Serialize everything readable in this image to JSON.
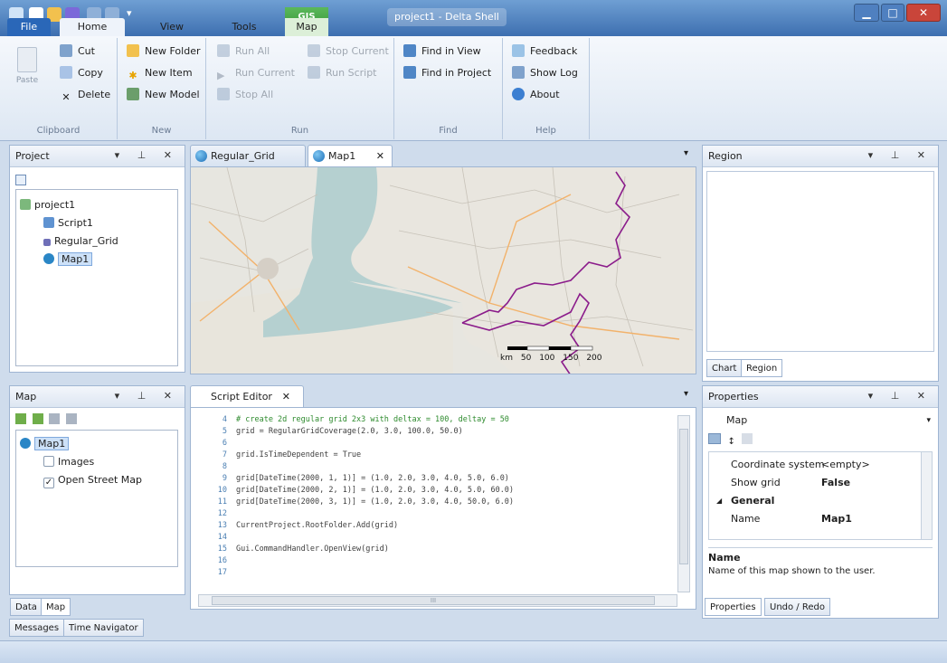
{
  "window": {
    "title": "project1 - Delta Shell",
    "contextual_tab_group": "GIS"
  },
  "ribbon_tabs": {
    "file": "File",
    "home": "Home",
    "view": "View",
    "tools": "Tools",
    "map": "Map"
  },
  "ribbon": {
    "clipboard": {
      "label": "Clipboard",
      "paste": "Paste",
      "cut": "Cut",
      "copy": "Copy",
      "delete": "Delete"
    },
    "new": {
      "label": "New",
      "new_folder": "New Folder",
      "new_item": "New Item",
      "new_model": "New Model"
    },
    "run": {
      "label": "Run",
      "run_all": "Run All",
      "run_current": "Run Current",
      "stop_all": "Stop All",
      "stop_current": "Stop Current",
      "run_script": "Run Script"
    },
    "find": {
      "label": "Find",
      "find_in_view": "Find in View",
      "find_in_project": "Find in Project"
    },
    "help": {
      "label": "Help",
      "feedback": "Feedback",
      "show_log": "Show Log",
      "about": "About"
    }
  },
  "project_panel": {
    "title": "Project",
    "tree": [
      {
        "label": "project1"
      },
      {
        "label": "Script1"
      },
      {
        "label": "Regular_Grid"
      },
      {
        "label": "Map1"
      }
    ]
  },
  "map_panel": {
    "title": "Map",
    "tree": [
      {
        "label": "Map1"
      },
      {
        "label": "Images"
      },
      {
        "label": "Open Street Map"
      }
    ],
    "bottom_tabs": [
      "Data",
      "Map"
    ]
  },
  "doc_tabs": [
    "Regular_Grid",
    "Map1"
  ],
  "map_view": {
    "scale_bar": {
      "unit": "km",
      "ticks": [
        "50",
        "100",
        "150",
        "200"
      ]
    }
  },
  "script_editor": {
    "tab": "Script Editor",
    "lines": [
      {
        "n": "4",
        "text": "# create 2d regular grid 2x3 with deltax = 100, deltay = 50"
      },
      {
        "n": "5",
        "text": "grid = RegularGridCoverage(2.0, 3.0, 100.0, 50.0)"
      },
      {
        "n": "6",
        "text": ""
      },
      {
        "n": "7",
        "text": "grid.IsTimeDependent = True"
      },
      {
        "n": "8",
        "text": ""
      },
      {
        "n": "9",
        "text": "grid[DateTime(2000, 1, 1)] = (1.0, 2.0, 3.0, 4.0, 5.0, 6.0)"
      },
      {
        "n": "10",
        "text": "grid[DateTime(2000, 2, 1)] = (1.0, 2.0, 3.0, 4.0, 5.0, 60.0)"
      },
      {
        "n": "11",
        "text": "grid[DateTime(2000, 3, 1)] = (1.0, 2.0, 3.0, 4.0, 50.0, 6.0)"
      },
      {
        "n": "12",
        "text": ""
      },
      {
        "n": "13",
        "text": "CurrentProject.RootFolder.Add(grid)"
      },
      {
        "n": "14",
        "text": ""
      },
      {
        "n": "15",
        "text": "Gui.CommandHandler.OpenView(grid)"
      },
      {
        "n": "16",
        "text": ""
      },
      {
        "n": "17",
        "text": ""
      }
    ],
    "hscroll_mark": "III"
  },
  "region_panel": {
    "title": "Region",
    "tabs": [
      "Chart",
      "Region"
    ]
  },
  "properties_panel": {
    "title": "Properties",
    "object": "Map",
    "rows": [
      {
        "key": "Coordinate system",
        "value": "<empty>"
      },
      {
        "key": "Show grid",
        "value": "False"
      }
    ],
    "category": "General",
    "name_row": {
      "key": "Name",
      "value": "Map1"
    },
    "desc_title": "Name",
    "desc_text": "Name of this map shown to the user.",
    "tabs": [
      "Properties",
      "Undo / Redo"
    ]
  },
  "bottom_tabs": [
    "Messages",
    "Time Navigator"
  ],
  "colors": {
    "accent": "#3d6fb0",
    "gis_green": "#3a9a3a",
    "border": "#8b1c8b"
  }
}
